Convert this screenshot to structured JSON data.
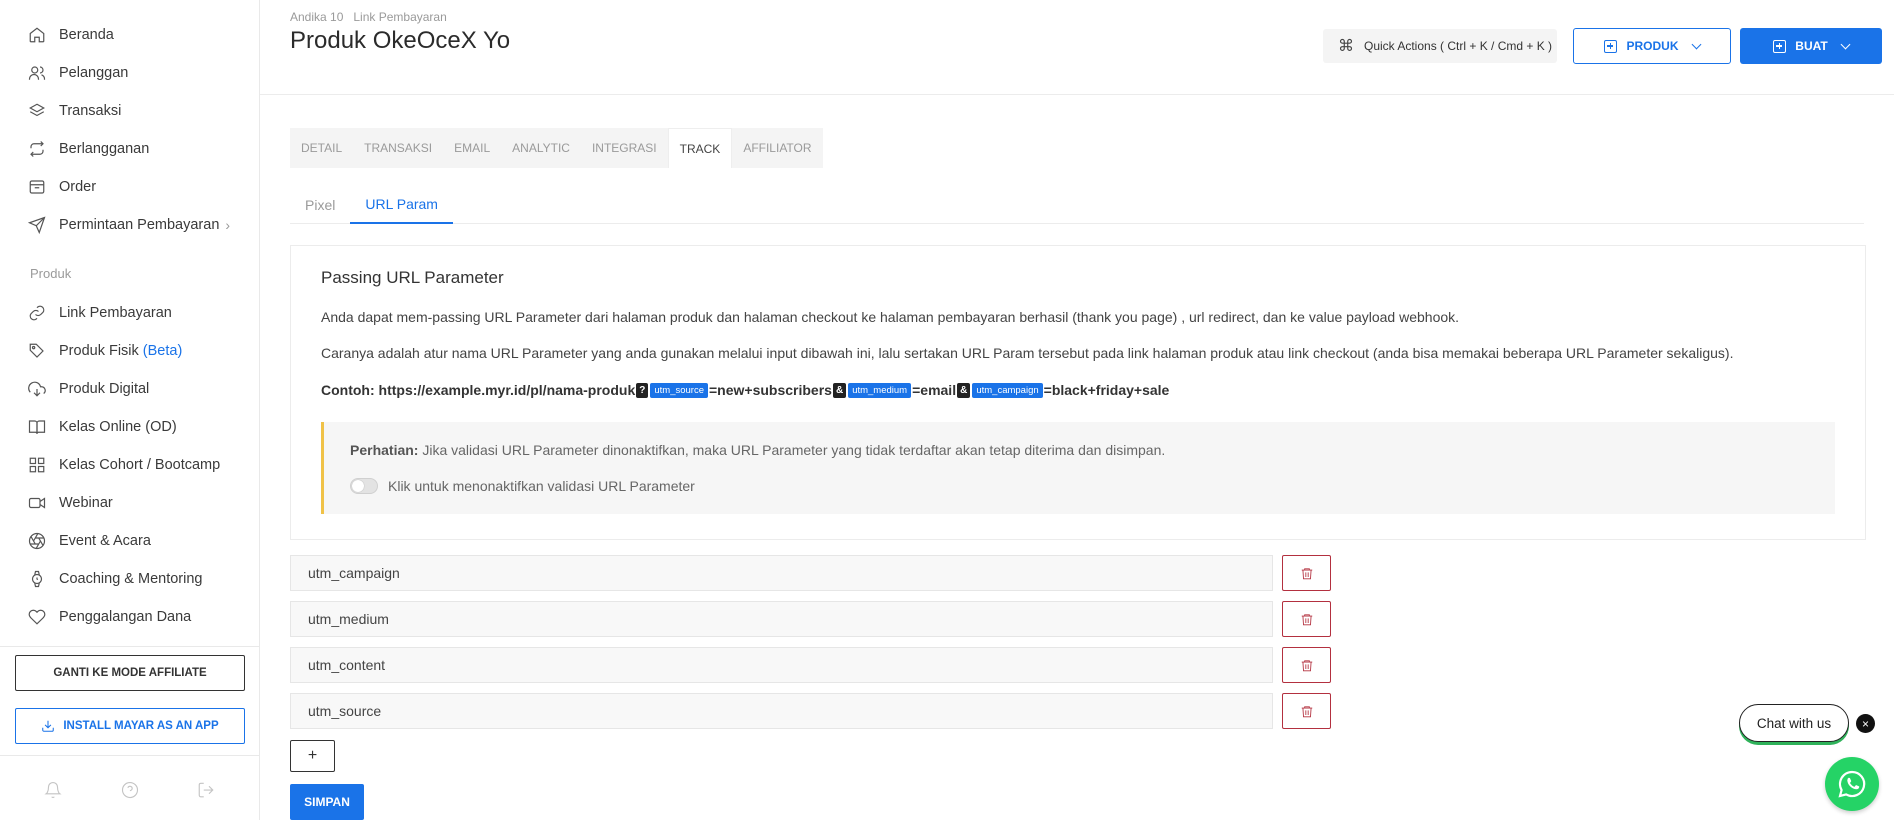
{
  "sidebar": {
    "items": [
      {
        "label": "Beranda",
        "icon": "home-icon"
      },
      {
        "label": "Pelanggan",
        "icon": "users-icon"
      },
      {
        "label": "Transaksi",
        "icon": "layers-icon"
      },
      {
        "label": "Berlangganan",
        "icon": "repeat-icon"
      },
      {
        "label": "Order",
        "icon": "inbox-icon"
      },
      {
        "label": "Permintaan Pembayaran",
        "icon": "send-icon"
      }
    ],
    "section_label": "Produk",
    "product_items": [
      {
        "label": "Link Pembayaran",
        "icon": "link-icon"
      },
      {
        "label": "Produk Fisik",
        "beta": "(Beta)",
        "icon": "tag-icon"
      },
      {
        "label": "Produk Digital",
        "icon": "cloud-download-icon"
      },
      {
        "label": "Kelas Online (OD)",
        "icon": "book-icon"
      },
      {
        "label": "Kelas Cohort / Bootcamp",
        "icon": "grid-icon"
      },
      {
        "label": "Webinar",
        "icon": "video-icon"
      },
      {
        "label": "Event & Acara",
        "icon": "aperture-icon"
      },
      {
        "label": "Coaching & Mentoring",
        "icon": "watch-icon"
      },
      {
        "label": "Penggalangan Dana",
        "icon": "heart-icon"
      }
    ],
    "affiliate_button": "GANTI KE MODE AFFILIATE",
    "install_button": "INSTALL MAYAR AS AN APP"
  },
  "header": {
    "breadcrumb": [
      "Andika 10",
      "Link Pembayaran"
    ],
    "title": "Produk OkeOceX Yo",
    "quick_actions": "Quick Actions ( Ctrl + K / Cmd + K )",
    "produk_button": "PRODUK",
    "buat_button": "BUAT"
  },
  "tabs": [
    "DETAIL",
    "TRANSAKSI",
    "EMAIL",
    "ANALYTIC",
    "INTEGRASI",
    "TRACK",
    "AFFILIATOR"
  ],
  "active_tab": "TRACK",
  "subtabs": [
    "Pixel",
    "URL Param"
  ],
  "active_subtab": "URL Param",
  "card": {
    "title": "Passing URL Parameter",
    "p1": "Anda dapat mem-passing URL Parameter dari halaman produk dan halaman checkout ke halaman pembayaran berhasil (thank you page) , url redirect, dan ke value payload webhook.",
    "p2": "Caranya adalah atur nama URL Parameter yang anda gunakan melalui input dibawah ini, lalu sertakan URL Param tersebut pada link halaman produk atau link checkout (anda bisa memakai beberapa URL Parameter sekaligus).",
    "example": {
      "prefix": "Contoh: https://example.myr.id/pl/nama-produk",
      "q": "?",
      "k1": "utm_source",
      "v1": "=new+subscribers",
      "amp1": "&",
      "k2": "utm_medium",
      "v2": "=email",
      "amp2": "&",
      "k3": "utm_campaign",
      "v3": "=black+friday+sale"
    },
    "notice_label": "Perhatian:",
    "notice_text": " Jika validasi URL Parameter dinonaktifkan, maka URL Parameter yang tidak terdaftar akan tetap diterima dan disimpan.",
    "toggle_label": "Klik untuk menonaktifkan validasi URL Parameter",
    "toggle_on": false
  },
  "params": [
    "utm_campaign",
    "utm_medium",
    "utm_content",
    "utm_source"
  ],
  "add_label": "+",
  "save_label": "SIMPAN",
  "chat": {
    "label": "Chat with us",
    "close": "×"
  },
  "colors": {
    "accent": "#1a73e8",
    "danger": "#b3303f",
    "notice_border": "#f0c247",
    "whatsapp": "#25d366"
  }
}
